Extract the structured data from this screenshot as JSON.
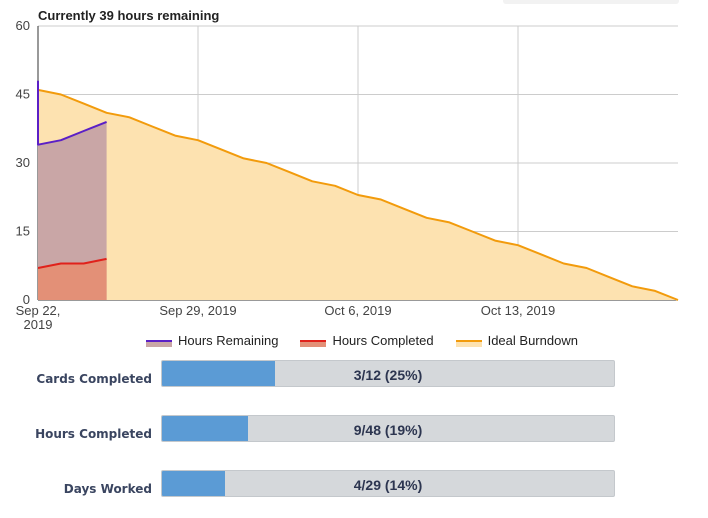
{
  "title": "Currently 39 hours remaining",
  "chart_data": {
    "type": "area",
    "x_start": "Sep 22, 2019",
    "x_ticks": [
      {
        "day": 0,
        "label_lines": [
          "Sep 22,",
          "2019"
        ]
      },
      {
        "day": 7,
        "label_lines": [
          "Sep 29, 2019"
        ]
      },
      {
        "day": 14,
        "label_lines": [
          "Oct 6, 2019"
        ]
      },
      {
        "day": 21,
        "label_lines": [
          "Oct 13, 2019"
        ]
      }
    ],
    "xlim": [
      0,
      28
    ],
    "ylim": [
      0,
      60
    ],
    "y_ticks": [
      0,
      15,
      30,
      45,
      60
    ],
    "grid": true,
    "legend_position": "bottom",
    "series": [
      {
        "name": "Hours Remaining",
        "color": "#5b1fc6",
        "fill": "#c9a6a6",
        "points": [
          [
            0,
            48
          ],
          [
            0,
            34
          ],
          [
            1,
            35
          ],
          [
            2,
            37
          ],
          [
            3,
            39
          ]
        ]
      },
      {
        "name": "Hours Completed",
        "color": "#e0211b",
        "fill": "#e39077",
        "points": [
          [
            0,
            7
          ],
          [
            1,
            8
          ],
          [
            2,
            8
          ],
          [
            3,
            9
          ]
        ]
      },
      {
        "name": "Ideal Burndown",
        "color": "#f29b0c",
        "fill": "#fde2b0",
        "points": [
          [
            0,
            46
          ],
          [
            1,
            45
          ],
          [
            2,
            43
          ],
          [
            3,
            41
          ],
          [
            4,
            40
          ],
          [
            5,
            38
          ],
          [
            6,
            36
          ],
          [
            7,
            35
          ],
          [
            8,
            33
          ],
          [
            9,
            31
          ],
          [
            10,
            30
          ],
          [
            11,
            28
          ],
          [
            12,
            26
          ],
          [
            13,
            25
          ],
          [
            14,
            23
          ],
          [
            15,
            22
          ],
          [
            16,
            20
          ],
          [
            17,
            18
          ],
          [
            18,
            17
          ],
          [
            19,
            15
          ],
          [
            20,
            13
          ],
          [
            21,
            12
          ],
          [
            22,
            10
          ],
          [
            23,
            8
          ],
          [
            24,
            7
          ],
          [
            25,
            5
          ],
          [
            26,
            3
          ],
          [
            27,
            2
          ],
          [
            28,
            0
          ]
        ]
      }
    ]
  },
  "stats": [
    {
      "label": "Cards Completed",
      "text": "3/12 (25%)",
      "fraction": 0.25
    },
    {
      "label": "Hours Completed",
      "text": "9/48 (19%)",
      "fraction": 0.19
    },
    {
      "label": "Days Worked",
      "text": "4/29 (14%)",
      "fraction": 0.14
    }
  ]
}
